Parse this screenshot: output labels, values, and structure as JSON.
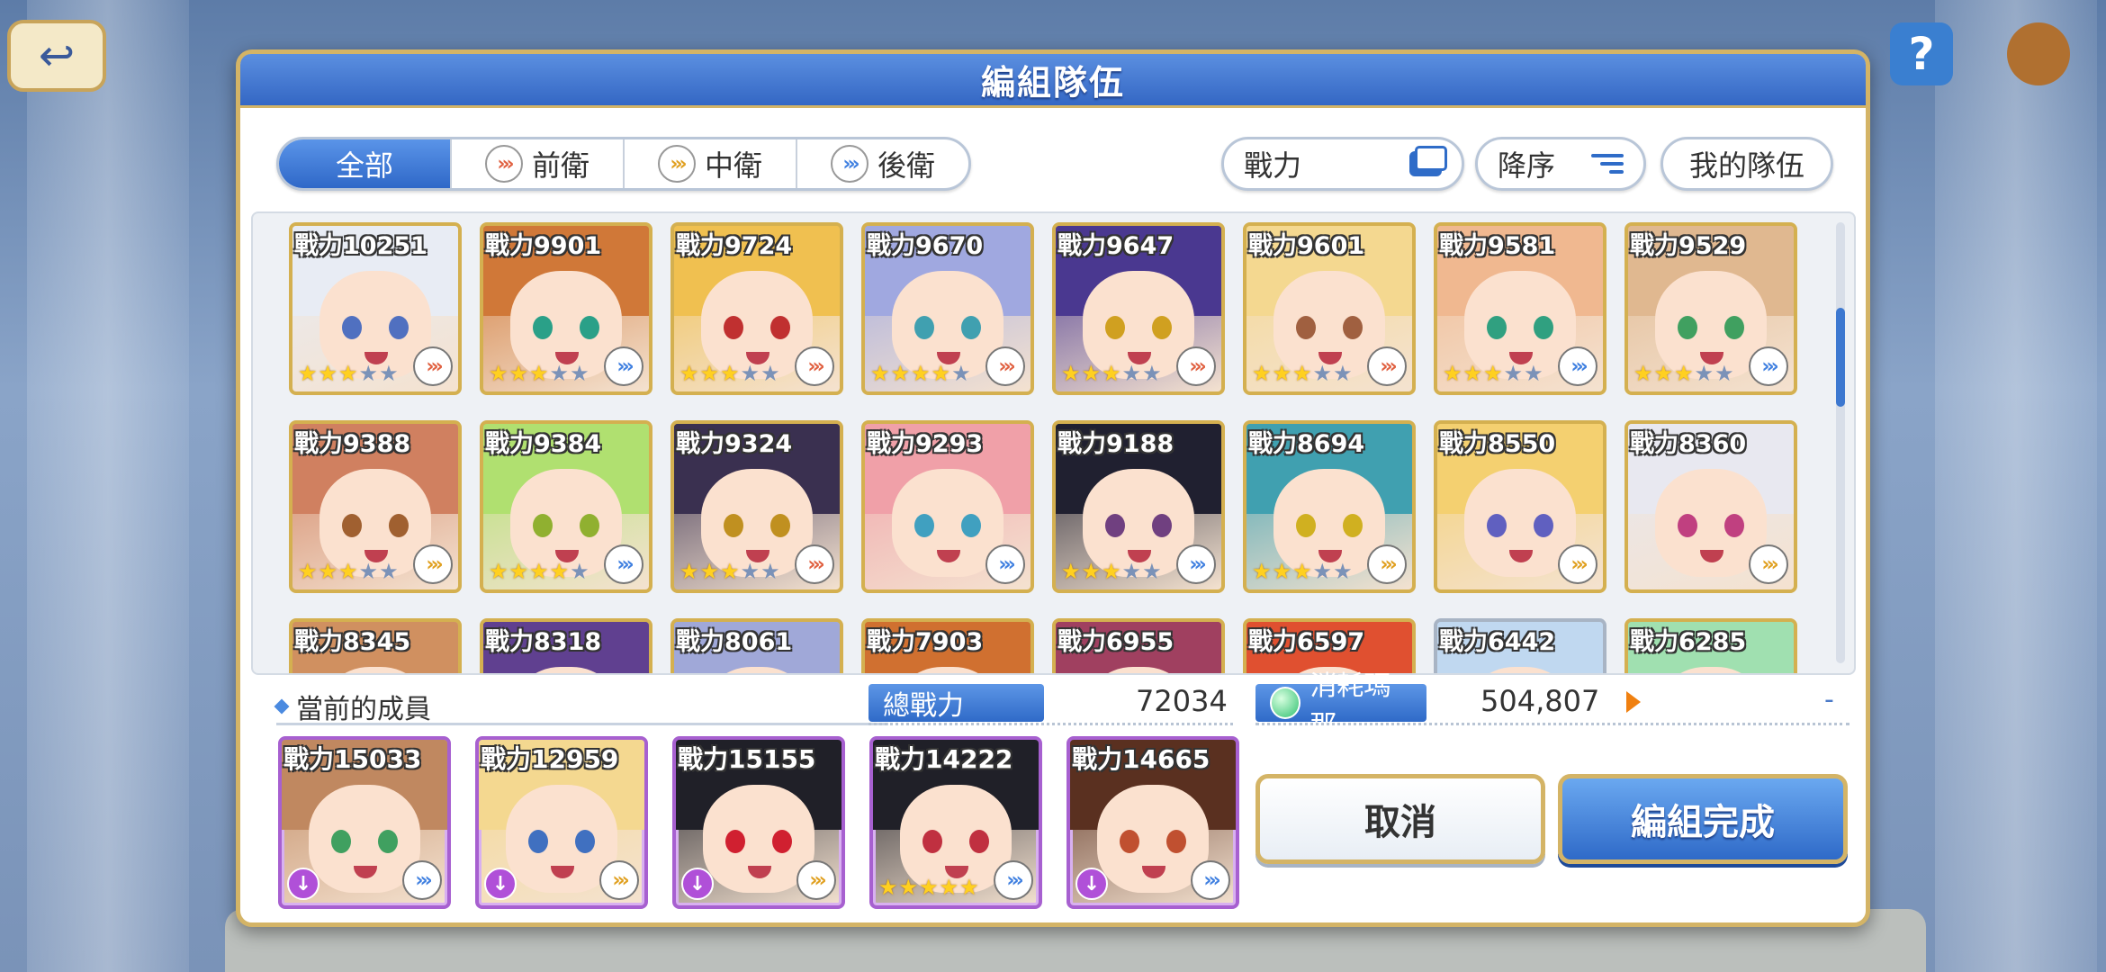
{
  "dialog": {
    "title": "編組隊伍"
  },
  "tabs": [
    {
      "label": "全部",
      "icon": "none",
      "active": true
    },
    {
      "label": "前衛",
      "icon": "front-role-icon"
    },
    {
      "label": "中衛",
      "icon": "mid-role-icon"
    },
    {
      "label": "後衛",
      "icon": "back-role-icon"
    }
  ],
  "sort": {
    "power_label": "戰力",
    "order_label": "降序",
    "my_team_label": "我的隊伍"
  },
  "roster": [
    {
      "power": "戰力10251",
      "stars": 3,
      "role": "front",
      "hair": "#e8ecf4",
      "eye": "#5070c0"
    },
    {
      "power": "戰力9901",
      "stars": 3,
      "role": "back",
      "hair": "#d07838",
      "eye": "#2aa088"
    },
    {
      "power": "戰力9724",
      "stars": 3,
      "role": "front",
      "hair": "#f0c050",
      "eye": "#c03030"
    },
    {
      "power": "戰力9670",
      "stars": 4,
      "role": "front",
      "hair": "#a0a8e0",
      "eye": "#40a0b0"
    },
    {
      "power": "戰力9647",
      "stars": 3,
      "role": "front",
      "hair": "#4a3890",
      "eye": "#d0a020"
    },
    {
      "power": "戰力9601",
      "stars": 3,
      "role": "front",
      "hair": "#f4d890",
      "eye": "#a06040"
    },
    {
      "power": "戰力9581",
      "stars": 3,
      "role": "back",
      "hair": "#f0b890",
      "eye": "#30a080"
    },
    {
      "power": "戰力9529",
      "stars": 3,
      "role": "back",
      "hair": "#e0b890",
      "eye": "#40a060"
    },
    {
      "power": "戰力9388",
      "stars": 3,
      "role": "mid",
      "hair": "#d08060",
      "eye": "#a06030"
    },
    {
      "power": "戰力9384",
      "stars": 4,
      "role": "back",
      "hair": "#b0e070",
      "eye": "#90b030"
    },
    {
      "power": "戰力9324",
      "stars": 3,
      "role": "front",
      "hair": "#3a3050",
      "eye": "#c09020"
    },
    {
      "power": "戰力9293",
      "stars": 0,
      "role": "back",
      "hair": "#f0a0a8",
      "eye": "#40a0c0"
    },
    {
      "power": "戰力9188",
      "stars": 3,
      "role": "back",
      "hair": "#202030",
      "eye": "#704080"
    },
    {
      "power": "戰力8694",
      "stars": 3,
      "role": "mid",
      "hair": "#40a0b0",
      "eye": "#d0b020"
    },
    {
      "power": "戰力8550",
      "stars": 0,
      "role": "mid",
      "hair": "#f4d070",
      "eye": "#6060c0"
    },
    {
      "power": "戰力8360",
      "stars": 0,
      "role": "mid",
      "hair": "#e8e8f0",
      "eye": "#c04080"
    },
    {
      "power": "戰力8345",
      "stars": 0,
      "role": "front",
      "hair": "#d09060",
      "eye": "#804020"
    },
    {
      "power": "戰力8318",
      "stars": 0,
      "role": "front",
      "hair": "#604090",
      "eye": "#804020"
    },
    {
      "power": "戰力8061",
      "stars": 0,
      "role": "front",
      "hair": "#a0a8d8",
      "eye": "#804020"
    },
    {
      "power": "戰力7903",
      "stars": 0,
      "role": "front",
      "hair": "#d07030",
      "eye": "#804020"
    },
    {
      "power": "戰力6955",
      "stars": 0,
      "role": "front",
      "hair": "#a04060",
      "eye": "#804020"
    },
    {
      "power": "戰力6597",
      "stars": 0,
      "role": "front",
      "hair": "#e05030",
      "eye": "#804020"
    },
    {
      "power": "戰力6442",
      "stars": 0,
      "role": "front",
      "hair": "#c0d8f0",
      "eye": "#804020",
      "silver": true
    },
    {
      "power": "戰力6285",
      "stars": 0,
      "role": "front",
      "hair": "#a0e0b0",
      "eye": "#804020"
    }
  ],
  "members_section": {
    "label": "當前的成員"
  },
  "totals": {
    "power_label": "總戰力",
    "power_value": "72034",
    "mana_label": "消耗瑪那",
    "mana_value": "504,807",
    "extra": "-"
  },
  "members": [
    {
      "power": "戰力15033",
      "stars": 0,
      "role": "back",
      "hair": "#c08860",
      "eye": "#40a060"
    },
    {
      "power": "戰力12959",
      "stars": 0,
      "role": "mid",
      "hair": "#f4d890",
      "eye": "#4070c0"
    },
    {
      "power": "戰力15155",
      "stars": 0,
      "role": "mid",
      "hair": "#202028",
      "eye": "#d02030"
    },
    {
      "power": "戰力14222",
      "stars": 5,
      "role": "back",
      "hair": "#202028",
      "eye": "#c03040"
    },
    {
      "power": "戰力14665",
      "stars": 0,
      "role": "back",
      "hair": "#5a3020",
      "eye": "#c05030"
    }
  ],
  "buttons": {
    "cancel": "取消",
    "confirm": "編組完成"
  },
  "colors": {
    "accent": "#2f6ac8",
    "gold_border": "#d4b466",
    "member_border": "#a760d0"
  }
}
